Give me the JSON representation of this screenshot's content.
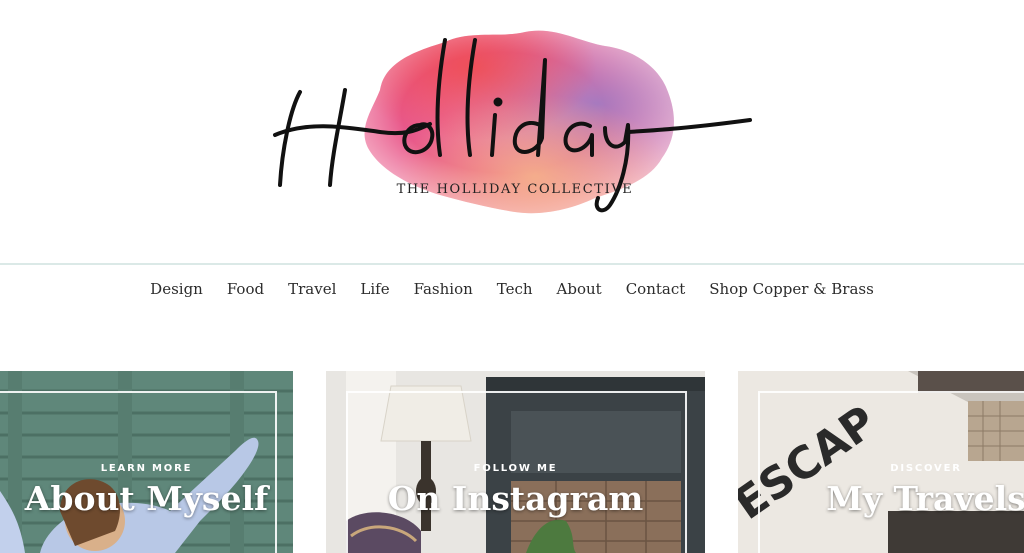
{
  "logo": {
    "tagline": "THE HOLLIDAY COLLECTIVE"
  },
  "nav": {
    "items": [
      {
        "label": "Design"
      },
      {
        "label": "Food"
      },
      {
        "label": "Travel"
      },
      {
        "label": "Life"
      },
      {
        "label": "Fashion"
      },
      {
        "label": "Tech"
      },
      {
        "label": "About"
      },
      {
        "label": "Contact"
      },
      {
        "label": "Shop Copper & Brass"
      }
    ]
  },
  "tiles": [
    {
      "kicker": "LEARN MORE",
      "title": "About Myself"
    },
    {
      "kicker": "FOLLOW ME",
      "title": "On Instagram"
    },
    {
      "kicker": "DISCOVER",
      "title": "My Travels"
    }
  ],
  "colors": {
    "text": "#2c2c2c",
    "divider": "#dbe9e7",
    "watercolor_pink": "#ec6a8e",
    "watercolor_purple": "#9b7fc8",
    "watercolor_peach": "#f6b48a"
  }
}
